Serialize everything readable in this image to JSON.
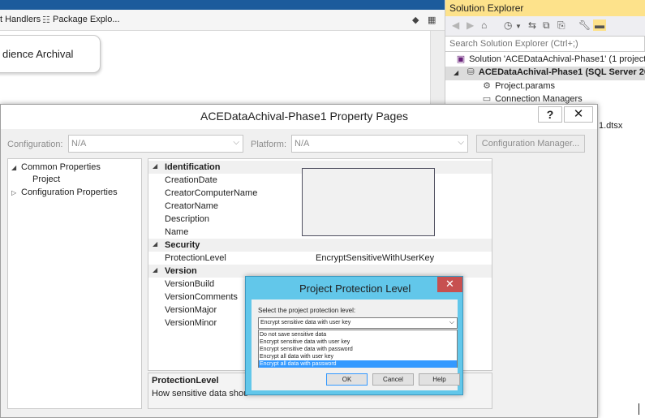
{
  "designer": {
    "tabs": [
      "t Handlers",
      "Package Explo..."
    ],
    "component_label": "dience Archival"
  },
  "solution_explorer": {
    "title": "Solution Explorer",
    "search_placeholder": "Search Solution Explorer (Ctrl+;)",
    "tree": {
      "solution": "Solution 'ACEDataAchival-Phase1' (1 project)",
      "project": "ACEDataAchival-Phase1 (SQL Server 201",
      "items": [
        "Project.params",
        "Connection Managers"
      ],
      "partial_item": "1.dtsx"
    }
  },
  "property_pages": {
    "title": "ACEDataAchival-Phase1 Property Pages",
    "help_label": "?",
    "close_label": "✕",
    "configuration_label": "Configuration:",
    "configuration_value": "N/A",
    "platform_label": "Platform:",
    "platform_value": "N/A",
    "config_manager_label": "Configuration Manager...",
    "tree": {
      "root": "Common Properties",
      "child": "Project",
      "sibling": "Configuration Properties"
    },
    "grid": {
      "categories": [
        {
          "name": "Identification",
          "props": [
            {
              "key": "CreationDate",
              "value": ""
            },
            {
              "key": "CreatorComputerName",
              "value": ""
            },
            {
              "key": "CreatorName",
              "value": ""
            },
            {
              "key": "Description",
              "value": ""
            },
            {
              "key": "Name",
              "value": ""
            }
          ]
        },
        {
          "name": "Security",
          "props": [
            {
              "key": "ProtectionLevel",
              "value": "EncryptSensitiveWithUserKey"
            }
          ]
        },
        {
          "name": "Version",
          "props": [
            {
              "key": "VersionBuild",
              "value": ""
            },
            {
              "key": "VersionComments",
              "value": ""
            },
            {
              "key": "VersionMajor",
              "value": ""
            },
            {
              "key": "VersionMinor",
              "value": ""
            }
          ]
        }
      ]
    },
    "description": {
      "title": "ProtectionLevel",
      "text": "How sensitive data should"
    }
  },
  "protection_dialog": {
    "title": "Project Protection Level",
    "close_label": "✕",
    "prompt": "Select the project protection level:",
    "selected_value": "Encrypt sensitive data with user key",
    "options": [
      "Do not save sensitive data",
      "Encrypt sensitive data with user key",
      "Encrypt sensitive data with password",
      "Encrypt all data with user key",
      "Encrypt all data with password"
    ],
    "highlighted_option_index": 4,
    "ok_label": "OK",
    "cancel_label": "Cancel",
    "help_label": "Help"
  }
}
